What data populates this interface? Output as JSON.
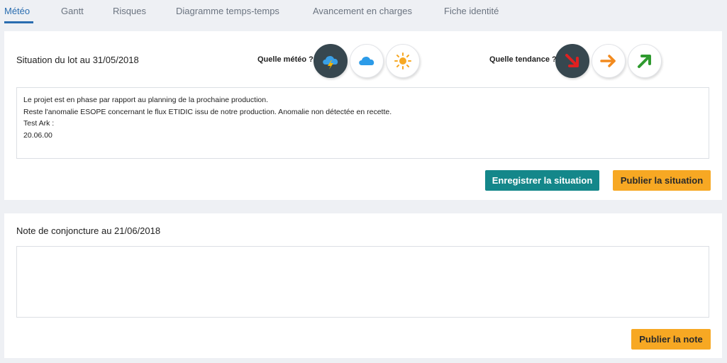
{
  "tabs": [
    {
      "label": "Météo"
    },
    {
      "label": "Gantt"
    },
    {
      "label": "Risques"
    },
    {
      "label": "Diagramme temps-temps"
    },
    {
      "label": "Avancement en charges"
    },
    {
      "label": "Fiche identité"
    }
  ],
  "situation": {
    "title": "Situation du lot au 31/05/2018",
    "meteo_label": "Quelle météo ?",
    "tendance_label": "Quelle tendance ?",
    "meteo_options": [
      {
        "icon": "storm-cloud-icon",
        "selected": true
      },
      {
        "icon": "cloud-icon",
        "selected": false
      },
      {
        "icon": "sun-icon",
        "selected": false
      }
    ],
    "tendance_options": [
      {
        "icon": "arrow-down-right-icon",
        "color": "#e02020",
        "selected": true
      },
      {
        "icon": "arrow-right-icon",
        "color": "#f28a1e",
        "selected": false
      },
      {
        "icon": "arrow-up-right-icon",
        "color": "#2f9a2f",
        "selected": false
      }
    ],
    "text_lines": [
      "Le projet est en phase par rapport au planning de la prochaine production.",
      "Reste l'anomalie ESOPE concernant le flux ETIDIC issu de notre production. Anomalie non détectée en recette.",
      "Test Ark :",
      "20.06.00"
    ],
    "save_label": "Enregistrer la situation",
    "publish_label": "Publier la situation"
  },
  "note": {
    "title": "Note de conjoncture au 21/06/2018",
    "text": "",
    "publish_label": "Publier la note"
  },
  "colors": {
    "accent": "#2a6db0",
    "teal": "#14878a",
    "orange": "#f7a823",
    "selected_circle": "#37474f"
  }
}
